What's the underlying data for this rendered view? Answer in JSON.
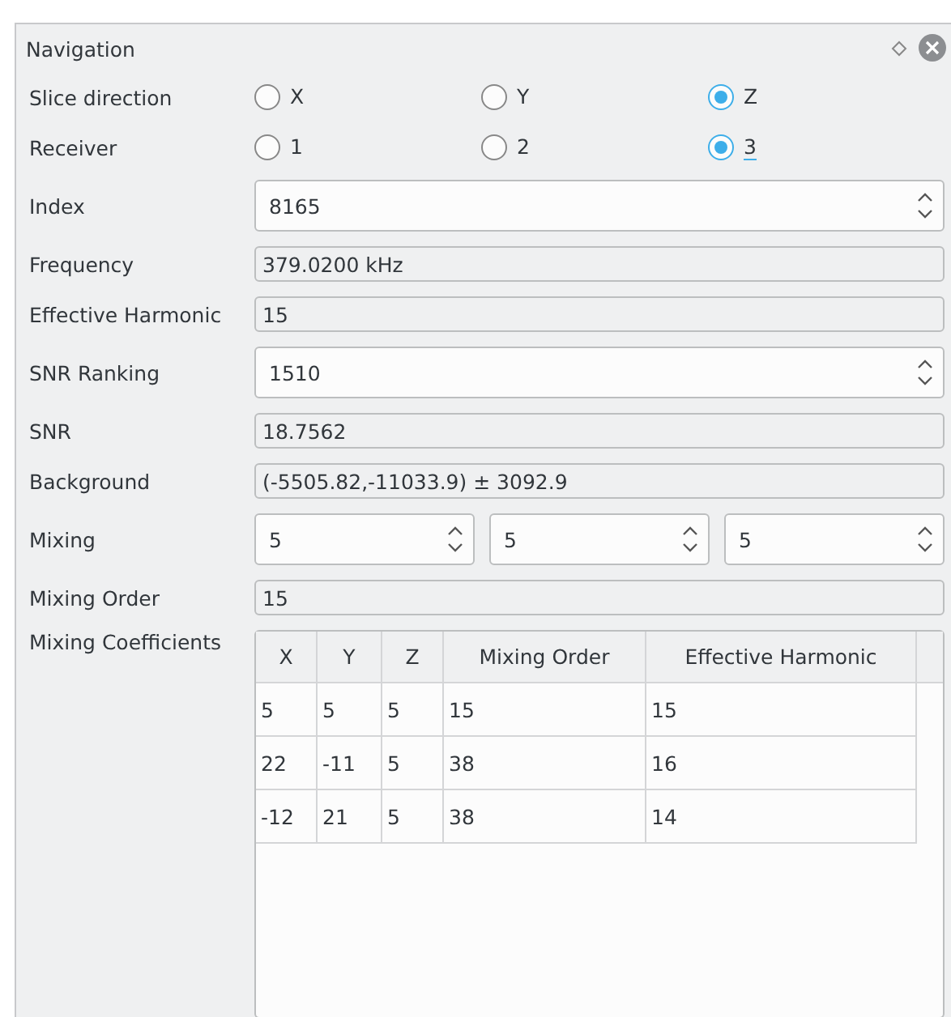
{
  "window": {
    "title": "Navigation"
  },
  "rows": [
    {
      "kind": "radio",
      "label": "Slice direction",
      "options": [
        {
          "label": "X",
          "selected": false,
          "focused": false
        },
        {
          "label": "Y",
          "selected": false,
          "focused": false
        },
        {
          "label": "Z",
          "selected": true,
          "focused": false
        }
      ]
    },
    {
      "kind": "radio",
      "label": "Receiver",
      "options": [
        {
          "label": "1",
          "selected": false,
          "focused": false
        },
        {
          "label": "2",
          "selected": false,
          "focused": false
        },
        {
          "label": "3",
          "selected": true,
          "focused": true
        }
      ]
    },
    {
      "kind": "spin",
      "label": "Index",
      "values": [
        "8165"
      ]
    },
    {
      "kind": "readonly",
      "label": "Frequency",
      "value": "379.0200 kHz"
    },
    {
      "kind": "readonly",
      "label": "Effective Harmonic",
      "value": "15"
    },
    {
      "kind": "spin",
      "label": "SNR Ranking",
      "values": [
        "1510"
      ]
    },
    {
      "kind": "readonly",
      "label": "SNR",
      "value": "18.7562"
    },
    {
      "kind": "readonly",
      "label": "Background",
      "value": "(-5505.82,-11033.9) ± 3092.9"
    },
    {
      "kind": "spin",
      "label": "Mixing",
      "values": [
        "5",
        "5",
        "5"
      ]
    },
    {
      "kind": "readonly",
      "label": "Mixing Order",
      "value": "15"
    },
    {
      "kind": "table",
      "label": "Mixing Coefficients",
      "columns": [
        "X",
        "Y",
        "Z",
        "Mixing Order",
        "Effective Harmonic"
      ],
      "rows": [
        [
          "5",
          "5",
          "5",
          "15",
          "15"
        ],
        [
          "22",
          "-11",
          "5",
          "38",
          "16"
        ],
        [
          "-12",
          "21",
          "5",
          "38",
          "14"
        ]
      ]
    }
  ]
}
